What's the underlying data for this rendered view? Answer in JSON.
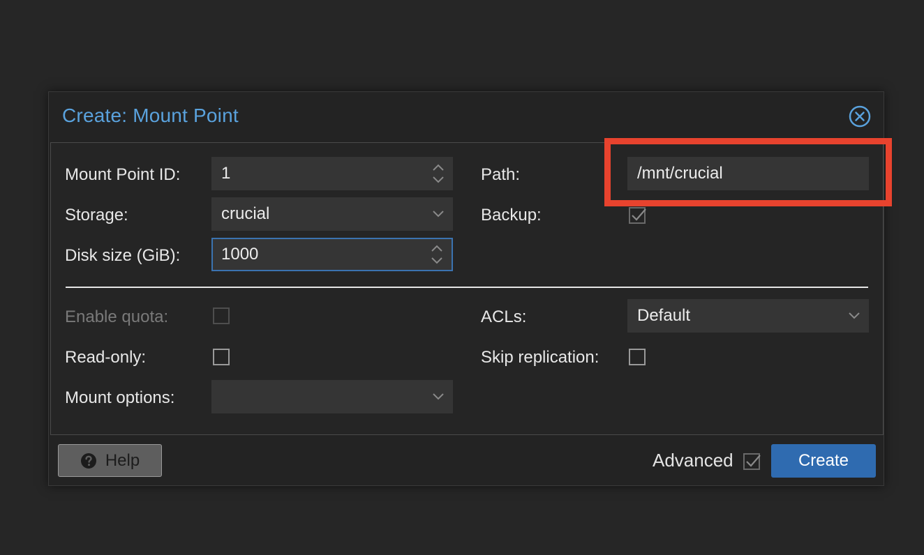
{
  "dialog": {
    "title": "Create: Mount Point",
    "close_icon": "close-circle-icon"
  },
  "form": {
    "mount_point_id": {
      "label": "Mount Point ID:",
      "value": "1"
    },
    "storage": {
      "label": "Storage:",
      "value": "crucial"
    },
    "disk_size": {
      "label": "Disk size (GiB):",
      "value": "1000"
    },
    "path": {
      "label": "Path:",
      "value": "/mnt/crucial"
    },
    "backup": {
      "label": "Backup:",
      "checked": true
    },
    "enable_quota": {
      "label": "Enable quota:",
      "checked": false,
      "disabled": true
    },
    "read_only": {
      "label": "Read-only:",
      "checked": false
    },
    "mount_options": {
      "label": "Mount options:",
      "value": ""
    },
    "acls": {
      "label": "ACLs:",
      "value": "Default"
    },
    "skip_replication": {
      "label": "Skip replication:",
      "checked": false
    }
  },
  "footer": {
    "help_label": "Help",
    "help_icon": "question-circle-icon",
    "advanced_label": "Advanced",
    "advanced_checked": true,
    "create_label": "Create"
  },
  "colors": {
    "accent": "#5aa2dd",
    "primary_button": "#2f6bb0",
    "highlight": "#e8432e",
    "background": "#262626"
  }
}
